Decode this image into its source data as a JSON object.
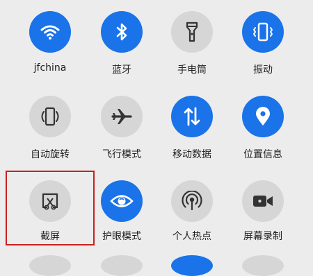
{
  "tiles": [
    {
      "label": "jfchina",
      "icon": "wifi-icon",
      "state": "on"
    },
    {
      "label": "蓝牙",
      "icon": "bluetooth-icon",
      "state": "on"
    },
    {
      "label": "手电筒",
      "icon": "flashlight-icon",
      "state": "off"
    },
    {
      "label": "振动",
      "icon": "vibrate-icon",
      "state": "on"
    },
    {
      "label": "自动旋转",
      "icon": "auto-rotate-icon",
      "state": "off"
    },
    {
      "label": "飞行模式",
      "icon": "airplane-icon",
      "state": "off"
    },
    {
      "label": "移动数据",
      "icon": "mobile-data-icon",
      "state": "on"
    },
    {
      "label": "位置信息",
      "icon": "location-icon",
      "state": "on"
    },
    {
      "label": "截屏",
      "icon": "screenshot-icon",
      "state": "off"
    },
    {
      "label": "护眼模式",
      "icon": "eye-comfort-icon",
      "state": "on"
    },
    {
      "label": "个人热点",
      "icon": "hotspot-icon",
      "state": "off"
    },
    {
      "label": "屏幕录制",
      "icon": "screen-record-icon",
      "state": "off"
    }
  ],
  "colors": {
    "on": "#1a73e8",
    "off": "#d6d6d6",
    "highlight": "#c8201f"
  }
}
